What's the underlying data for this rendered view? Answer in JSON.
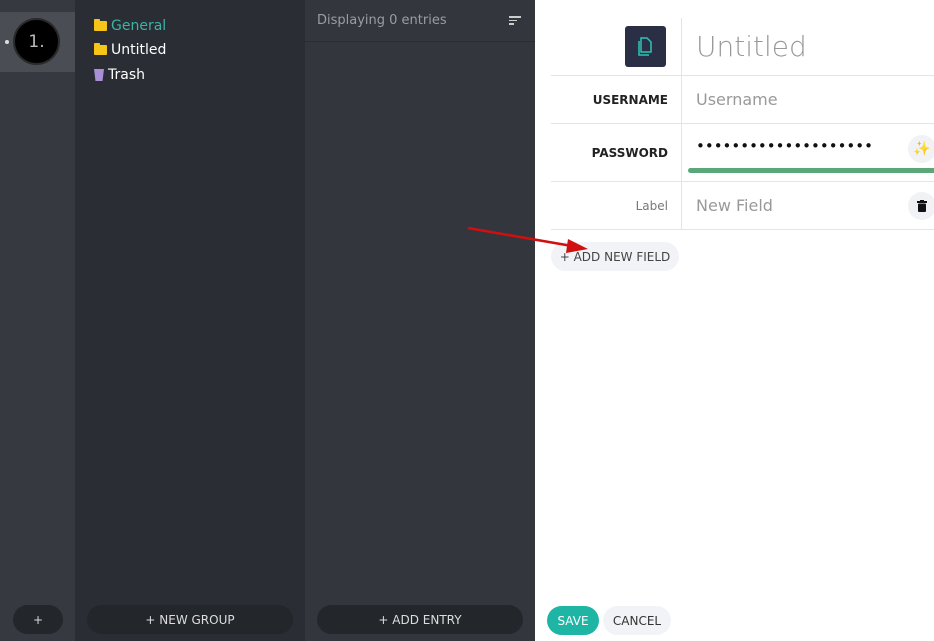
{
  "archives": {
    "items": [
      {
        "label": "1."
      }
    ],
    "add_label": "+"
  },
  "groups": {
    "items": [
      {
        "label": "General",
        "icon": "folder-icon",
        "active": true
      },
      {
        "label": "Untitled",
        "icon": "folder-icon"
      },
      {
        "label": "Trash",
        "icon": "trash-icon"
      }
    ],
    "new_group_label": "+ NEW GROUP"
  },
  "entries": {
    "status": "Displaying 0 entries",
    "add_entry_label": "+ ADD ENTRY"
  },
  "editor": {
    "title": "Untitled",
    "username_label": "USERNAME",
    "username_placeholder": "Username",
    "password_label": "PASSWORD",
    "password_value": "••••••••••••••••••••",
    "custom_label": "Label",
    "custom_placeholder": "New Field",
    "add_field_label": "+ ADD NEW FIELD",
    "save_label": "SAVE",
    "cancel_label": "CANCEL",
    "strength_color": "#5aa77a",
    "accent": "#1fb5a5"
  }
}
